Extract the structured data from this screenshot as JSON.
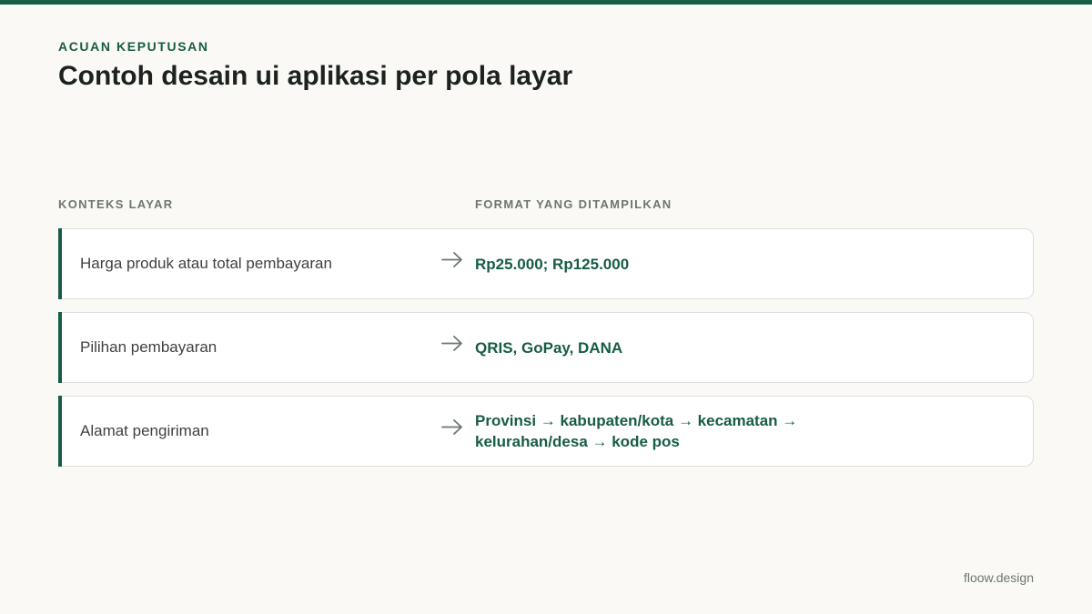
{
  "header": {
    "eyebrow": "ACUAN KEPUTUSAN",
    "title": "Contoh desain ui aplikasi per pola layar"
  },
  "columns": {
    "context": "KONTEKS LAYAR",
    "format": "FORMAT YANG DITAMPILKAN"
  },
  "rows": [
    {
      "context": "Harga produk atau total pembayaran",
      "format": "Rp25.000; Rp125.000"
    },
    {
      "context": "Pilihan pembayaran",
      "format": "QRIS, GoPay, DANA"
    },
    {
      "context": "Alamat pengiriman",
      "format": "Provinsi → kabupaten/kota → kecamatan → kelurahan/desa → kode pos"
    }
  ],
  "icons": {
    "row_arrow": "arrow-right-icon"
  },
  "colors": {
    "accent": "#175c46",
    "background": "#faf9f5",
    "card": "#ffffff",
    "muted": "#6f766f"
  },
  "footer": {
    "brand": "floow.design"
  }
}
